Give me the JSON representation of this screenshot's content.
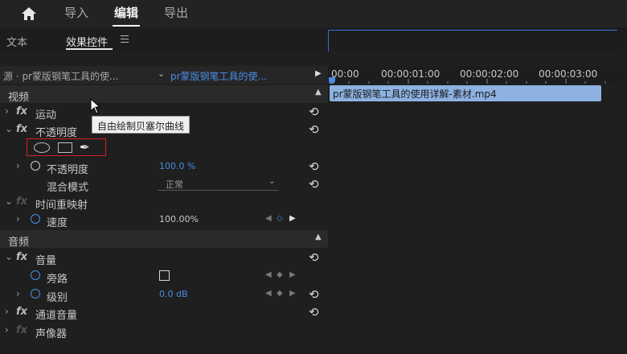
{
  "topbar": {
    "home_icon": "home-icon",
    "tabs": [
      {
        "label": "导入",
        "active": false
      },
      {
        "label": "编辑",
        "active": true
      },
      {
        "label": "导出",
        "active": false
      }
    ]
  },
  "panel": {
    "tabs": [
      {
        "label": "文本",
        "active": false
      },
      {
        "label": "效果控件",
        "active": true
      }
    ],
    "menu_icon": "hamburger-menu-icon"
  },
  "source": {
    "left": "源 · pr蒙版钢笔工具的使...",
    "right": "pr蒙版钢笔工具的使..."
  },
  "sections": {
    "video": "视频",
    "audio": "音频"
  },
  "effects": {
    "motion": "运动",
    "opacity": "不透明度",
    "opacity_param": "不透明度",
    "opacity_value": "100.0 %",
    "blend_mode": "混合模式",
    "blend_value": "正常",
    "time_remap": "时间重映射",
    "speed": "速度",
    "speed_value": "100.00%",
    "volume": "音量",
    "bypass": "旁路",
    "level": "级别",
    "level_value": "0.0 dB",
    "channel_volume": "通道音量",
    "panner": "声像器"
  },
  "mask_tools": {
    "tooltip": "自由绘制贝塞尔曲线",
    "icons": [
      "ellipse-mask-icon",
      "rectangle-mask-icon",
      "pen-mask-icon"
    ]
  },
  "timeline": {
    "timecodes": [
      "00:00",
      "00:00:01:00",
      "00:00:02:00",
      "00:00:03:00"
    ],
    "clip_name": "pr蒙版钢笔工具的使用详解-素材.mp4"
  },
  "colors": {
    "accent_blue": "#4a8ee6",
    "clip_blue": "#8db2e2",
    "highlight_red": "#d62020"
  }
}
